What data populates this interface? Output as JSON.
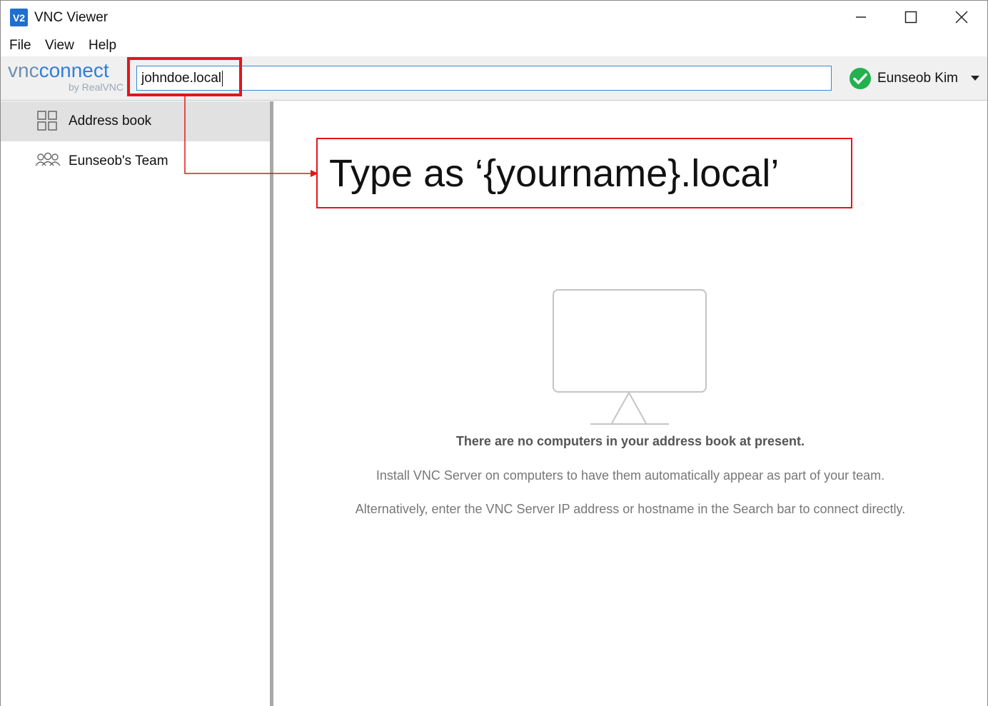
{
  "window": {
    "title": "VNC Viewer",
    "icon_label": "V2",
    "controls": [
      "minimize-icon",
      "maximize-icon",
      "close-icon"
    ]
  },
  "menu": {
    "items": [
      "File",
      "View",
      "Help"
    ]
  },
  "toolbar": {
    "logo_vnc": "vnc",
    "logo_connect": "connect",
    "logo_sub": "by RealVNC",
    "search_value": "johndoe.local",
    "user_name": "Eunseob Kim",
    "user_status_icon": "check-circle-icon",
    "user_status_color": "#23b14d"
  },
  "sidebar": {
    "items": [
      {
        "label": "Address book",
        "icon": "grid-icon",
        "selected": true
      },
      {
        "label": "Eunseob's Team",
        "icon": "team-icon",
        "selected": false
      }
    ]
  },
  "main": {
    "empty_title": "There are no computers in your address book at present.",
    "empty_line1": "Install VNC Server on computers to have them automatically appear as part of your team.",
    "empty_line2": "Alternatively, enter the VNC Server IP address or hostname in the Search bar to connect directly.",
    "empty_icon": "monitor-icon"
  },
  "annotation": {
    "callout_text": "Type as ‘{yourname}.local’",
    "color": "#e3161b"
  }
}
